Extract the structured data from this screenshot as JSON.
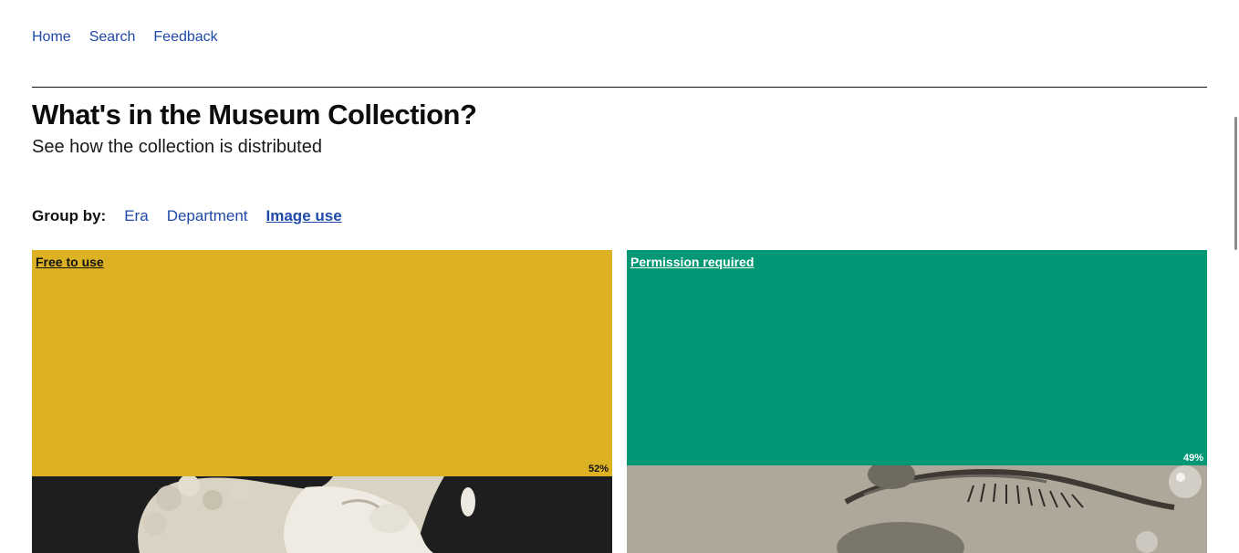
{
  "nav": {
    "home": "Home",
    "search": "Search",
    "feedback": "Feedback"
  },
  "header": {
    "title": "What's in the Museum Collection?",
    "subtitle": "See how the collection is distributed"
  },
  "groupby": {
    "label": "Group by:",
    "options": [
      "Era",
      "Department",
      "Image use"
    ],
    "selected": "Image use"
  },
  "tiles": [
    {
      "label": "Free to use",
      "percent_text": "52%",
      "percent": 52,
      "color": "#dcb224",
      "image": "marble-bust-photo"
    },
    {
      "label": "Permission required",
      "percent_text": "49%",
      "percent": 49,
      "color": "#029775",
      "image": "tearful-eye-photo"
    }
  ]
}
